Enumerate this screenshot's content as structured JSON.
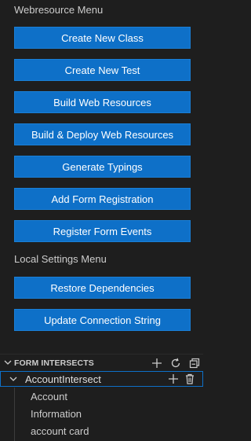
{
  "webresource_menu": {
    "label": "Webresource Menu",
    "buttons": [
      "Create New Class",
      "Create New Test",
      "Build Web Resources",
      "Build & Deploy Web Resources",
      "Generate Typings",
      "Add Form Registration",
      "Register Form Events"
    ]
  },
  "local_settings_menu": {
    "label": "Local Settings Menu",
    "buttons": [
      "Restore Dependencies",
      "Update Connection String"
    ]
  },
  "form_intersects": {
    "title": "FORM INTERSECTS",
    "icons": [
      "plus-icon",
      "refresh-icon",
      "collapse-all-icon"
    ],
    "tree": {
      "label": "AccountIntersect",
      "icons": [
        "plus-icon",
        "trash-icon"
      ],
      "children": [
        "Account",
        "Information",
        "account card"
      ]
    }
  },
  "colors": {
    "background": "#1e1e1e",
    "button": "#0e70c8",
    "focus_border": "#0e70c8",
    "text": "#cccccc"
  }
}
